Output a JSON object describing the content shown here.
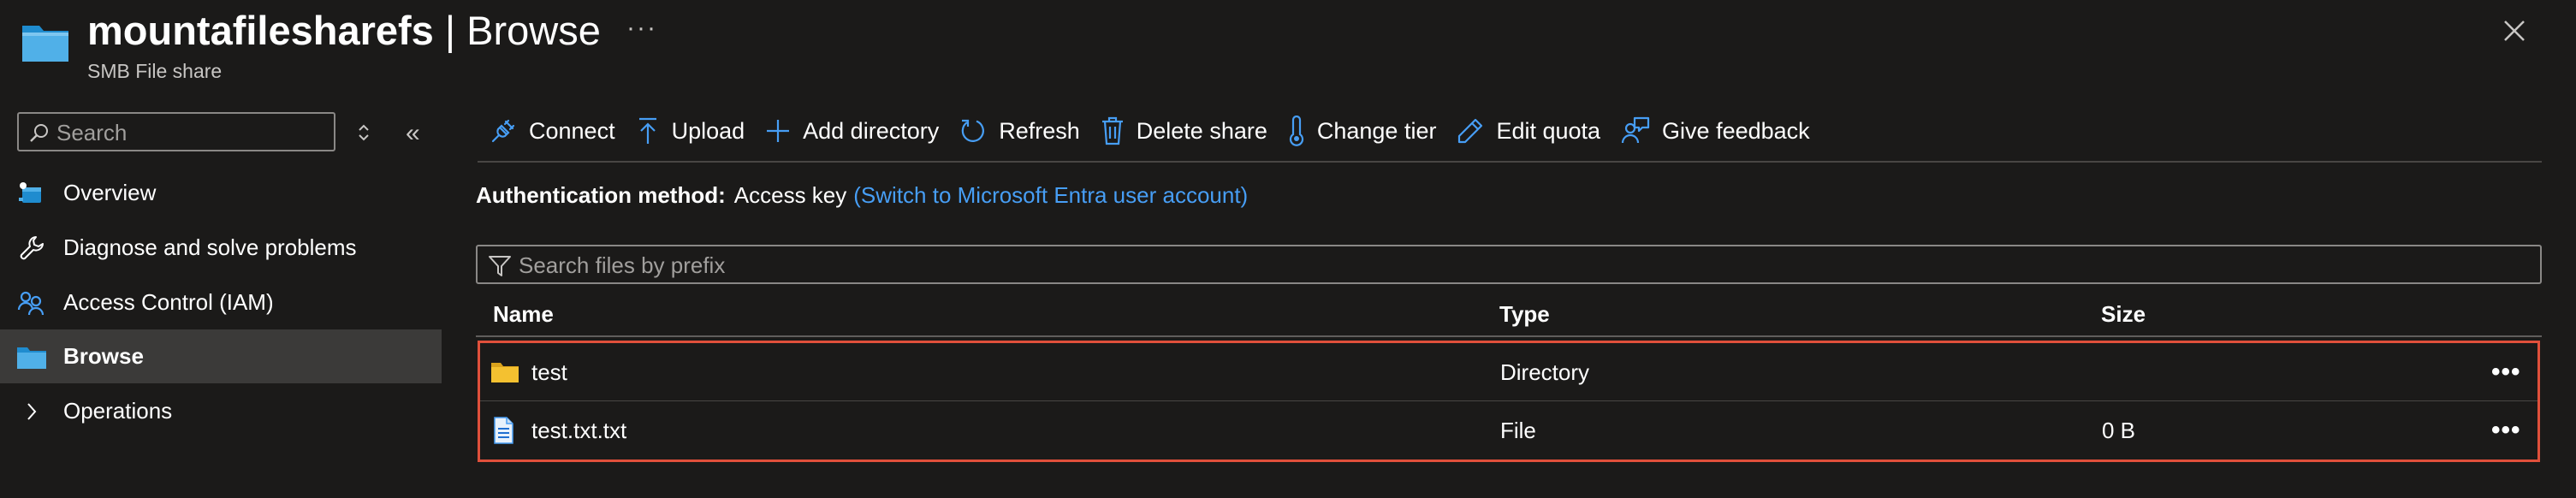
{
  "header": {
    "resource_name": "mountafilesharefs",
    "separator": " | ",
    "page_name": "Browse",
    "subtitle": "SMB File share",
    "more_label": "···",
    "icon": "file-share-folder-icon",
    "close_icon": "close-icon"
  },
  "sidebar": {
    "search_placeholder": "Search",
    "collapse_label": "«",
    "items": [
      {
        "label": "Overview",
        "icon": "overview-icon"
      },
      {
        "label": "Diagnose and solve problems",
        "icon": "wrench-icon"
      },
      {
        "label": "Access Control (IAM)",
        "icon": "people-icon"
      },
      {
        "label": "Browse",
        "icon": "folder-icon",
        "active": true
      },
      {
        "label": "Operations",
        "icon": "chevron-right-icon"
      }
    ]
  },
  "toolbar": {
    "connect": "Connect",
    "upload": "Upload",
    "add_directory": "Add directory",
    "refresh": "Refresh",
    "delete_share": "Delete share",
    "change_tier": "Change tier",
    "edit_quota": "Edit quota",
    "give_feedback": "Give feedback"
  },
  "auth": {
    "label": "Authentication method:",
    "value": "Access key",
    "link": "(Switch to Microsoft Entra user account)"
  },
  "filter": {
    "placeholder": "Search files by prefix"
  },
  "table": {
    "columns": [
      "Name",
      "Type",
      "Size"
    ],
    "rows": [
      {
        "name": "test",
        "type": "Directory",
        "size": "",
        "icon": "folder-icon",
        "more": "•••"
      },
      {
        "name": "test.txt.txt",
        "type": "File",
        "size": "0 B",
        "icon": "file-icon",
        "more": "•••"
      }
    ]
  },
  "colors": {
    "background": "#1b1a19",
    "accent_blue": "#479ef5",
    "selection_outline": "#e0503b",
    "folder_yellow": "#f4c130",
    "active_nav": "#3b3a39"
  }
}
